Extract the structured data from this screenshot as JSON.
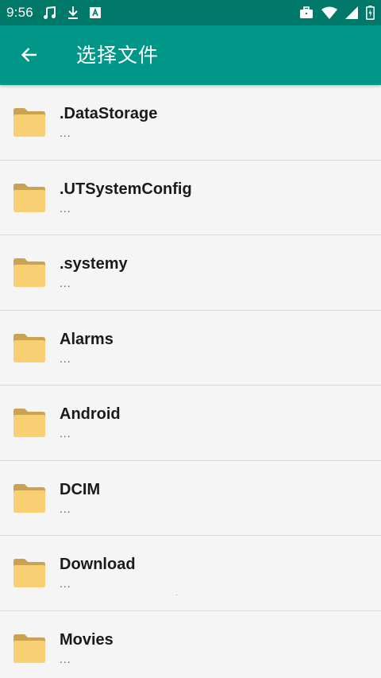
{
  "status_bar": {
    "time": "9:56",
    "notification_icons": [
      "music-note-icon",
      "download-icon",
      "accessibility-a-icon"
    ],
    "system_icons": [
      "briefcase-icon",
      "wifi-icon",
      "signal-icon",
      "battery-icon"
    ]
  },
  "app_bar": {
    "title": "选择文件",
    "back_icon": "arrow-back-icon",
    "color": "#009688",
    "status_color": "#00796b"
  },
  "files": [
    {
      "name": ".DataStorage",
      "sub": "..."
    },
    {
      "name": ".UTSystemConfig",
      "sub": "..."
    },
    {
      "name": ".systemy",
      "sub": "..."
    },
    {
      "name": "Alarms",
      "sub": "..."
    },
    {
      "name": "Android",
      "sub": "..."
    },
    {
      "name": "DCIM",
      "sub": "..."
    },
    {
      "name": "Download",
      "sub": "..."
    },
    {
      "name": "Movies",
      "sub": "..."
    }
  ],
  "folder_icon": "folder-icon",
  "folder_color": "#f9cf73"
}
